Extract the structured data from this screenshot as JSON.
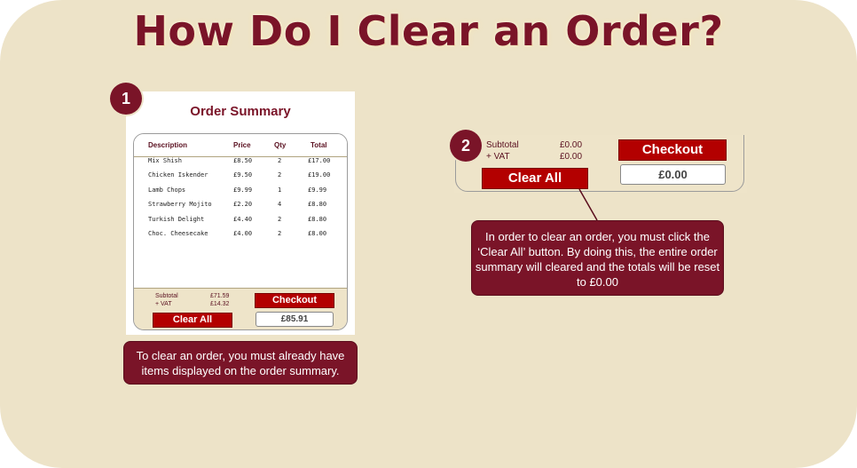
{
  "title": "How Do I Clear an Order?",
  "steps": {
    "one": "1",
    "two": "2"
  },
  "order_summary": {
    "heading": "Order Summary",
    "columns": [
      "Description",
      "Price",
      "Qty",
      "Total"
    ],
    "rows": [
      [
        "Mix Shish",
        "£8.50",
        "2",
        "£17.00"
      ],
      [
        "Chicken Iskender",
        "£9.50",
        "2",
        "£19.00"
      ],
      [
        "Lamb Chops",
        "£9.99",
        "1",
        "£9.99"
      ],
      [
        "Strawberry Mojito",
        "£2.20",
        "4",
        "£8.80"
      ],
      [
        "Turkish Delight",
        "£4.40",
        "2",
        "£8.80"
      ],
      [
        "Choc. Cheesecake",
        "£4.00",
        "2",
        "£8.00"
      ]
    ],
    "subtotal_label": "Subtotal",
    "subtotal_value": "£71.59",
    "vat_label": "+ VAT",
    "vat_value": "£14.32",
    "checkout_label": "Checkout",
    "clear_label": "Clear All",
    "grand_total": "£85.91"
  },
  "cleared_panel": {
    "subtotal_label": "Subtotal",
    "subtotal_value": "£0.00",
    "vat_label": "+ VAT",
    "vat_value": "£0.00",
    "checkout_label": "Checkout",
    "clear_label": "Clear All",
    "grand_total": "£0.00"
  },
  "callouts": {
    "step1": "To clear an order, you must already have items displayed on the order summary.",
    "step2": "In order to clear an order, you must click the ‘Clear All’ button. By doing this, the entire order summary will cleared and the totals will be reset to £0.00"
  },
  "colors": {
    "background": "#ede3c8",
    "accent": "#7a1428",
    "button": "#b30000"
  }
}
